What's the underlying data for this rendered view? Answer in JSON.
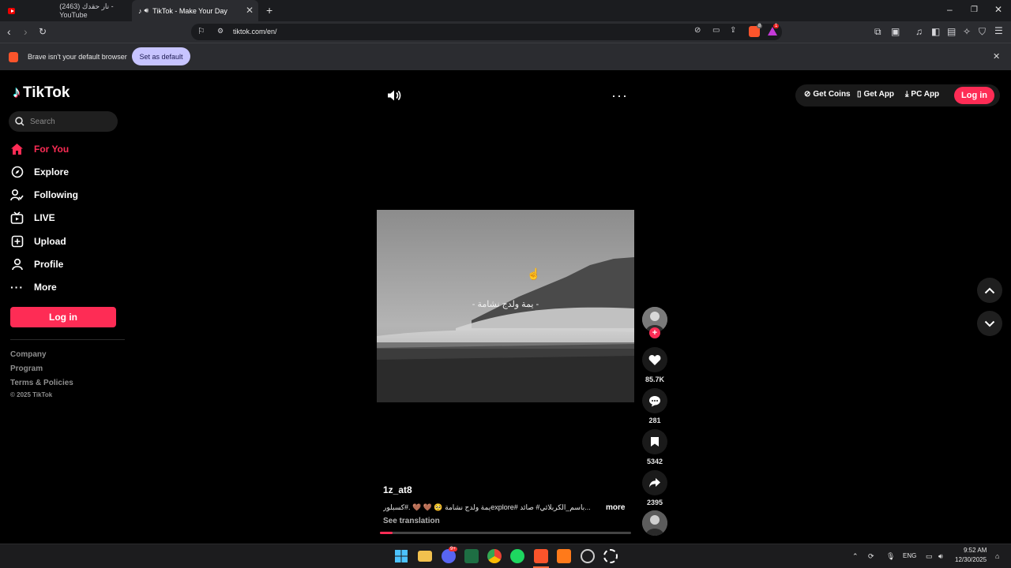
{
  "browser": {
    "tabs": [
      {
        "label": "(2463) نار حقدك - YouTube"
      },
      {
        "label": "TikTok - Make Your Day"
      }
    ],
    "url": "tiktok.com/en/",
    "infobar_text": "Brave isn't your default browser",
    "infobar_button": "Set as default",
    "brave_badge": "8",
    "rewards_badge": "1"
  },
  "tiktok": {
    "logo": "TikTok",
    "search_placeholder": "Search",
    "nav": [
      {
        "label": "For You",
        "icon": "home-icon",
        "active": true
      },
      {
        "label": "Explore",
        "icon": "compass-icon"
      },
      {
        "label": "Following",
        "icon": "following-icon"
      },
      {
        "label": "LIVE",
        "icon": "live-icon"
      },
      {
        "label": "Upload",
        "icon": "upload-icon"
      },
      {
        "label": "Profile",
        "icon": "profile-icon"
      },
      {
        "label": "More",
        "icon": "more-icon"
      }
    ],
    "side_login": "Log in",
    "footer": [
      "Company",
      "Program",
      "Terms & Policies",
      "© 2025 TikTok"
    ],
    "top_buttons": {
      "get_coins": "Get Coins",
      "get_app": "Get App",
      "pc_app": "PC App",
      "login": "Log in"
    },
    "video": {
      "overlay_text": "- يمة ولدج نشامة -",
      "author": "1z_at8",
      "description": "يمة ولدج نشامة 🥺 🤎 🤎 .#كسبلورexplore# باسم_الكربلائي# صائد...",
      "more": "more",
      "see_translation": "See translation",
      "likes": "85.7K",
      "comments": "281",
      "saves": "5342",
      "shares": "2395",
      "progress": 0.05
    }
  },
  "taskbar": {
    "lang": "ENG",
    "time": "9:52 AM",
    "date": "12/30/2025",
    "discord_badge": "9+"
  },
  "colors": {
    "accent": "#fe2c55",
    "chrome_bg": "#2b2c30"
  }
}
